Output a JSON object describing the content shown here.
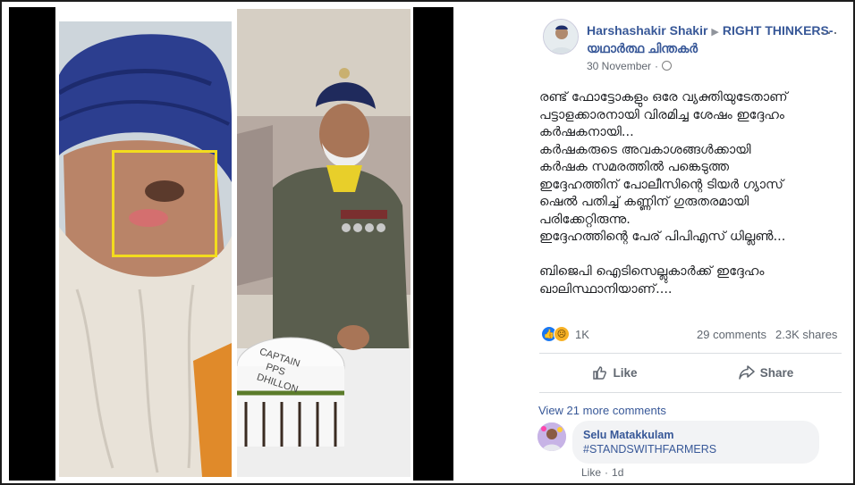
{
  "post": {
    "author": "Harshashakir Shakir",
    "group": "RIGHT THINKERS- യഥാർത്ഥ ചിന്തകർ",
    "timestamp": "30 November",
    "dot": "·",
    "menu": "···",
    "body": "രണ്ട് ഫോട്ടോകളും ഒരേ വ്യക്തിയുടേതാണ്\nപട്ടാളക്കാരനായി വിരമിച്ച ശേഷം ഇദ്ദേഹം\nകർഷകനായി...\nകർഷകരുടെ അവകാശങ്ങൾക്കായി\nകർഷക സമരത്തിൽ പങ്കെടുത്ത\nഇദ്ദേഹത്തിന് പോലീസിന്റെ ടിയർ ഗ്യാസ്\nഷെൽ പതിച്ച് കണ്ണിന് ഗുരുതരമായി\nപരിക്കേറ്റിരുന്നു.\nഇദ്ദേഹത്തിന്റെ പേര് പിപിഎസ് ധില്ലൺ...\n\nബിജെപി ഐടിസെല്ലുകാർക്ക് ഇദ്ദേഹം\nഖാലിസ്ഥാനിയാണ്...."
  },
  "reactions": {
    "count": "1K",
    "like_icon": "thumbs-up-icon",
    "sad_icon": "sad-face-icon"
  },
  "stats": {
    "comments": "29 comments",
    "shares": "2.3K shares"
  },
  "actions": {
    "like_label": "Like",
    "share_label": "Share"
  },
  "comments": {
    "view_more": "View 21 more comments",
    "items": [
      {
        "author": "Selu Matakkulam",
        "text": "#STANDSWITHFARMERS",
        "like_label": "Like",
        "time": "1d"
      }
    ]
  },
  "image": {
    "cake_text": "CAPTAIN PPS DHILLON"
  },
  "colors": {
    "link": "#385898",
    "highlight": "#f2dc1e",
    "turban": "#2c3e8f"
  }
}
